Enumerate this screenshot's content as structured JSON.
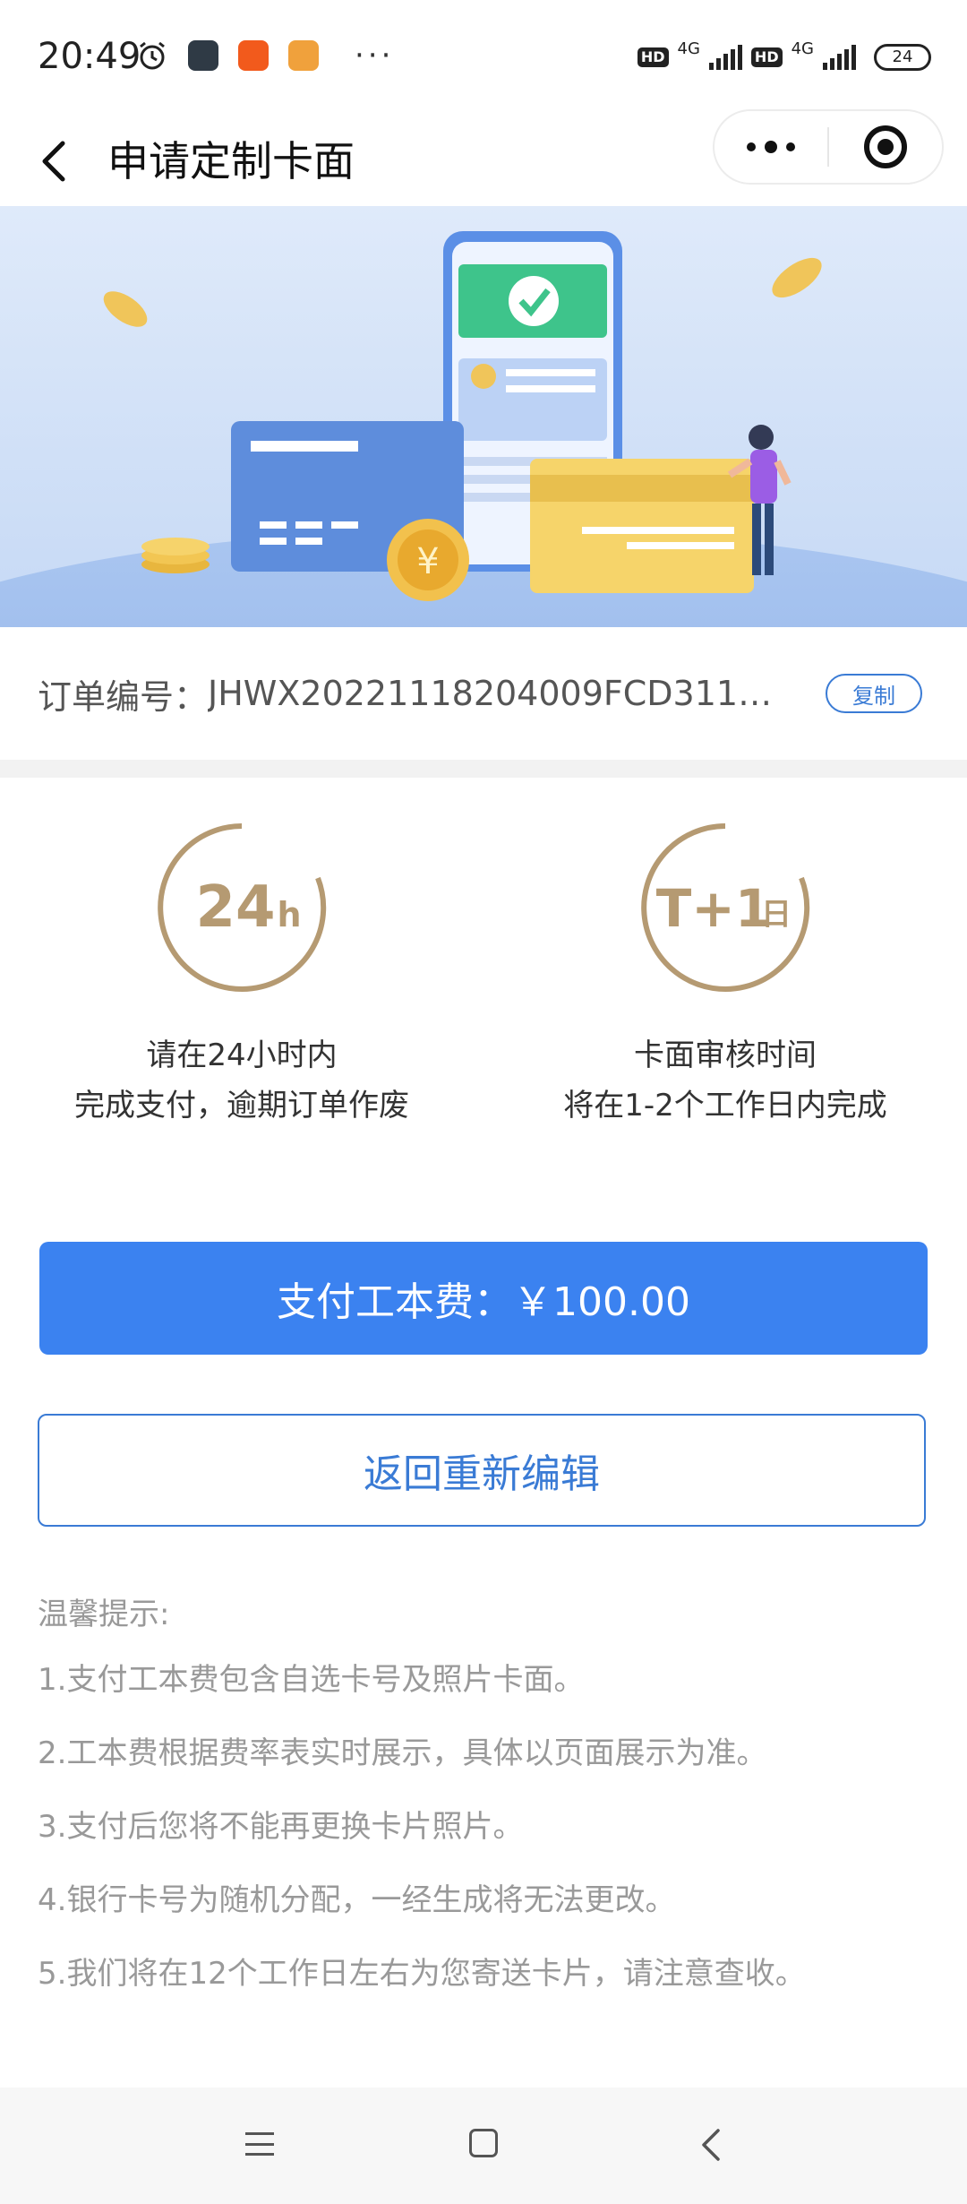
{
  "status_bar": {
    "time": "20:49",
    "more_dots": "···",
    "hd_label": "HD",
    "network_type": "4G",
    "battery": "24"
  },
  "nav": {
    "title": "申请定制卡面"
  },
  "order": {
    "label": "订单编号：",
    "number": "JHWX20221118204009FCD3110…",
    "copy_label": "复制"
  },
  "info": {
    "left": {
      "badge_main": "24",
      "badge_sub": "h",
      "line1": "请在24小时内",
      "line2": "完成支付，逾期订单作废"
    },
    "right": {
      "badge_main": "T+1",
      "badge_sub": "日",
      "line1": "卡面审核时间",
      "line2": "将在1-2个工作日内完成"
    }
  },
  "actions": {
    "pay_label": "支付工本费：￥100.00",
    "edit_label": "返回重新编辑"
  },
  "tips": {
    "title": "温馨提示:",
    "items": [
      "1.支付工本费包含自选卡号及照片卡面。",
      "2.工本费根据费率表实时展示，具体以页面展示为准。",
      "3.支付后您将不能再更换卡片照片。",
      "4.银行卡号为随机分配，一经生成将无法更改。",
      "5.我们将在12个工作日左右为您寄送卡片，请注意查收。"
    ]
  },
  "colors": {
    "primary": "#3b82f0",
    "badge_gold": "#b59a72",
    "tip_text": "#999999"
  }
}
